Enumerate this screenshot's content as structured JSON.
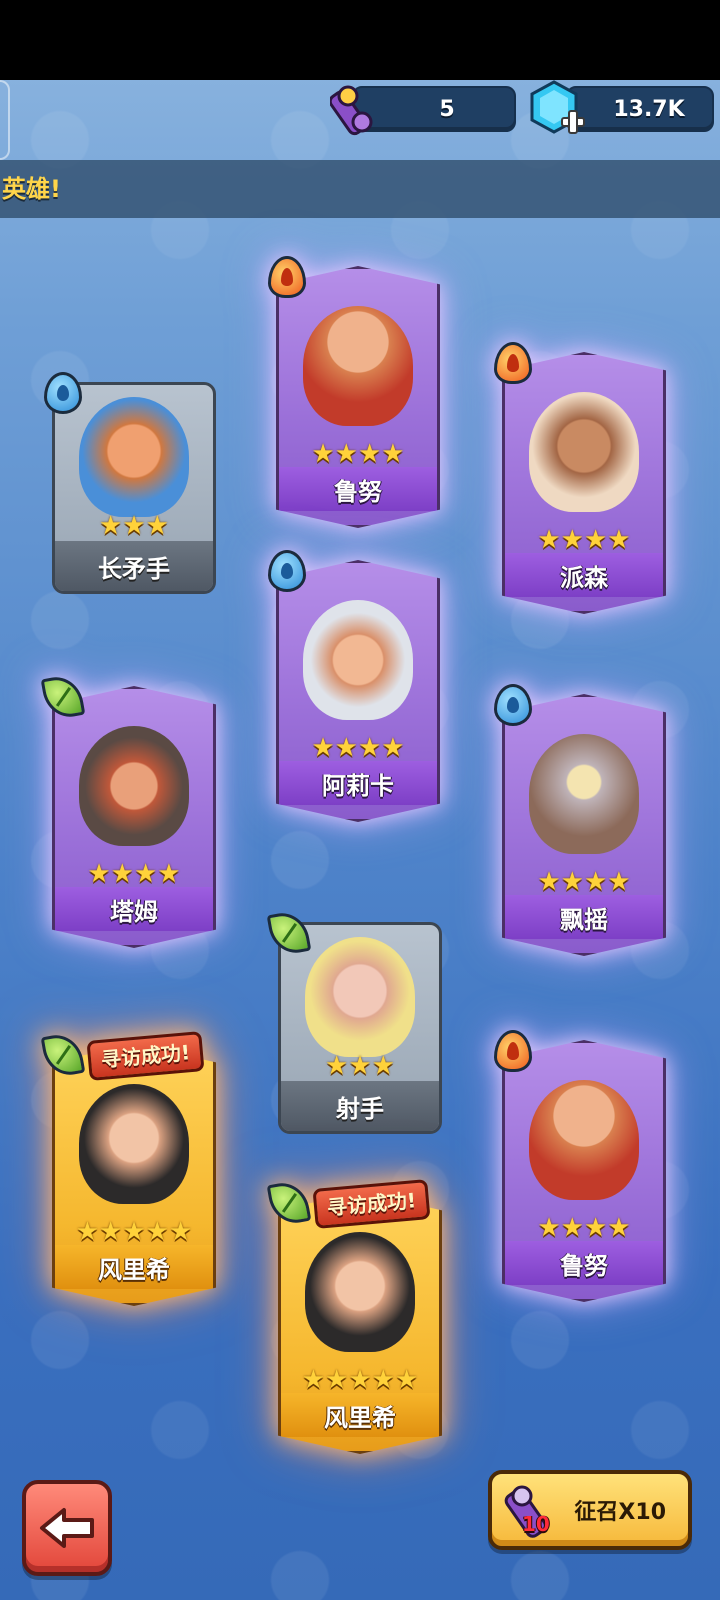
{
  "currency": {
    "scrolls": "5",
    "gems": "13.7K"
  },
  "banner": {
    "text": "英雄!"
  },
  "heroes": [
    {
      "name": "鲁努",
      "stars": "★★★★",
      "element": "fire",
      "rarity": "purple"
    },
    {
      "name": "长矛手",
      "stars": "★★★",
      "element": "water",
      "rarity": "gray"
    },
    {
      "name": "派森",
      "stars": "★★★★",
      "element": "fire",
      "rarity": "purple"
    },
    {
      "name": "阿莉卡",
      "stars": "★★★★",
      "element": "water",
      "rarity": "purple"
    },
    {
      "name": "塔姆",
      "stars": "★★★★",
      "element": "leaf",
      "rarity": "purple"
    },
    {
      "name": "飘摇",
      "stars": "★★★★",
      "element": "water",
      "rarity": "purple"
    },
    {
      "name": "射手",
      "stars": "★★★",
      "element": "leaf",
      "rarity": "gray"
    },
    {
      "name": "风里希",
      "stars": "★★★★★",
      "element": "leaf",
      "rarity": "gold",
      "tag": "寻访成功!"
    },
    {
      "name": "鲁努",
      "stars": "★★★★",
      "element": "fire",
      "rarity": "purple"
    },
    {
      "name": "风里希",
      "stars": "★★★★★",
      "element": "leaf",
      "rarity": "gold",
      "tag": "寻访成功!"
    }
  ],
  "buttons": {
    "summon_label": "征召X10",
    "summon_count": "10"
  },
  "colors": {
    "purple_card": "#9a6fd8",
    "gold_card": "#f5b72e",
    "gray_card": "#98a5b3",
    "star": "#ffd23a",
    "banner_text": "#ffd54a"
  }
}
